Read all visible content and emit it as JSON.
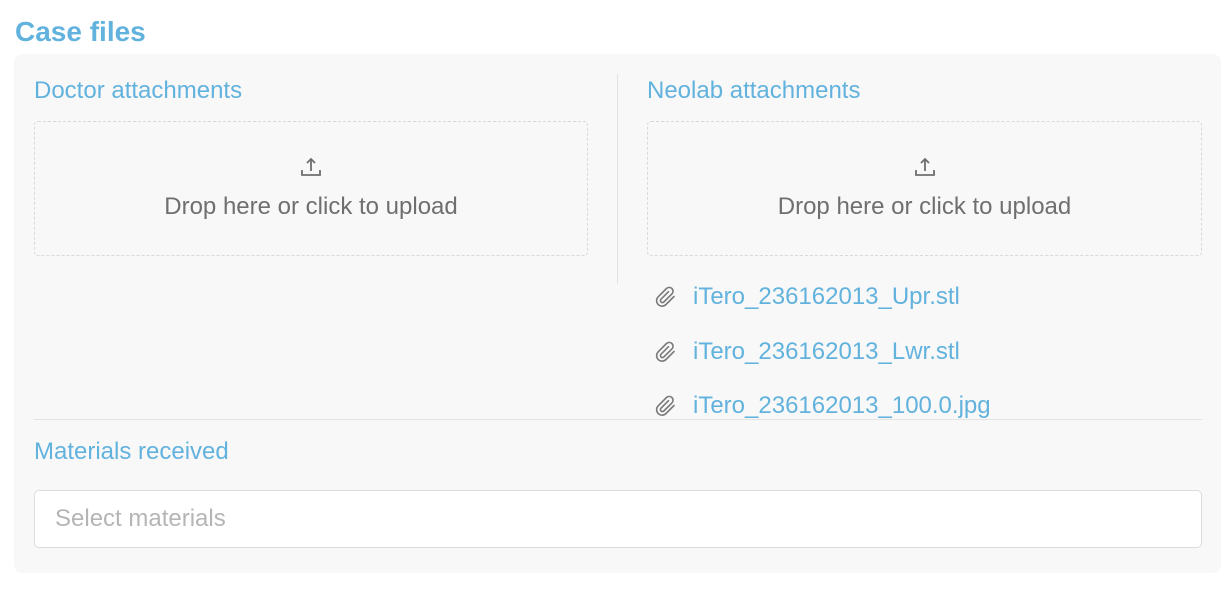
{
  "section": {
    "title": "Case files"
  },
  "doctor": {
    "heading": "Doctor attachments",
    "dropzone_text": "Drop here or click to upload"
  },
  "neolab": {
    "heading": "Neolab attachments",
    "dropzone_text": "Drop here or click to upload",
    "files": [
      {
        "name": "iTero_236162013_Upr.stl",
        "icon": "paperclip-icon"
      },
      {
        "name": "iTero_236162013_Lwr.stl",
        "icon": "paperclip-icon"
      },
      {
        "name": "iTero_236162013_100.0.jpg",
        "icon": "paperclip-icon"
      }
    ]
  },
  "materials": {
    "heading": "Materials received",
    "placeholder": "Select materials"
  },
  "colors": {
    "accent": "#62b2de",
    "panel_bg": "#f8f8f8",
    "muted_text": "#6f6f6f",
    "placeholder": "#b5b5b5"
  }
}
